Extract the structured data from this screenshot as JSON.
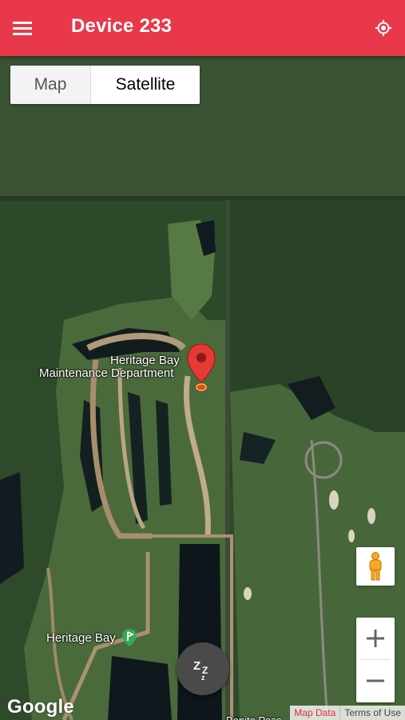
{
  "app_bar": {
    "menu_icon": "hamburger-menu-icon",
    "title": "Device 233",
    "locate_icon": "my-location-icon",
    "color": "#e8384a"
  },
  "map_type_toggle": {
    "options": [
      "Map",
      "Satellite"
    ],
    "selected": "Satellite"
  },
  "map": {
    "view": "satellite",
    "labels": {
      "maintenance_line1": "Heritage Bay",
      "maintenance_line2": "Maintenance Department",
      "heritage_bay": "Heritage Bay",
      "bottom_road": "Bonito Pass"
    },
    "marker_icon": "red-map-pin-icon",
    "pegman_icon": "street-view-pegman-icon",
    "zoom_in_label": "+",
    "zoom_out_label": "−",
    "logo": "Google",
    "attribution": {
      "map_data": "Map Data",
      "terms": "Terms of Use"
    }
  },
  "sleep_button": {
    "icon": "sleep-zzz-icon",
    "label": "ZZz"
  }
}
